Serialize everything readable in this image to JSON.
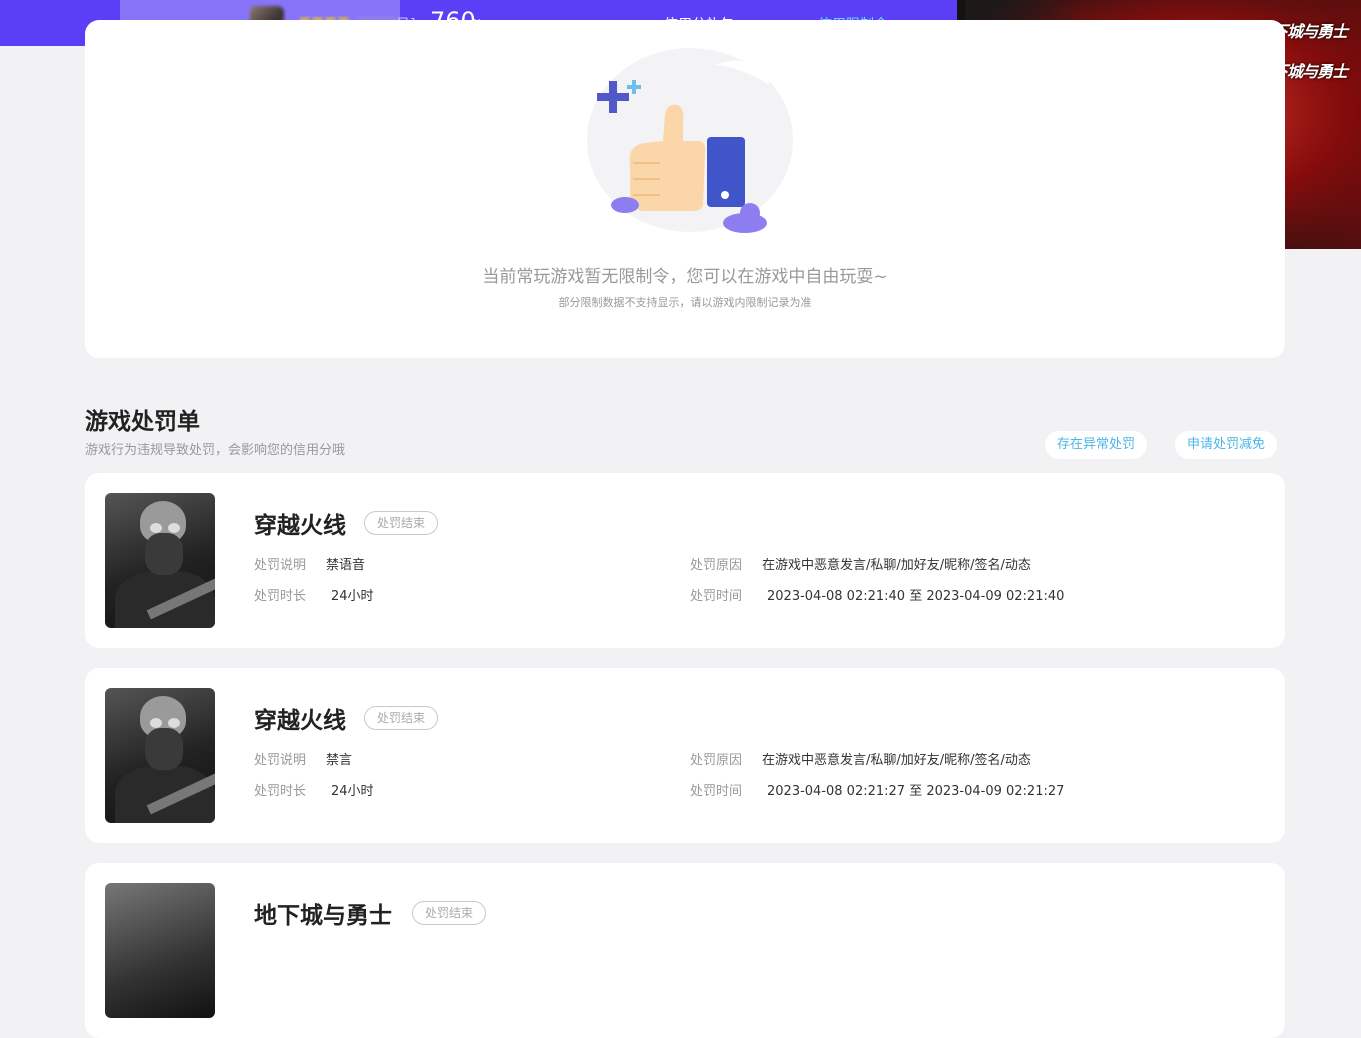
{
  "header": {
    "account_suffix": "号]",
    "credit_score": "760",
    "score_unit": "分",
    "tabs": [
      {
        "label": "信用分礼包",
        "active": false
      },
      {
        "label": "信用限制令",
        "active": true
      }
    ]
  },
  "colors": {
    "topbar": "#5a3ff7",
    "active_tab": "#4ad0ff",
    "link": "#4ab7e8"
  },
  "ad_banner": {
    "logo_text": "地下城与勇士"
  },
  "restrictions": {
    "empty_title": "当前常玩游戏暂无限制令，您可以在游戏中自由玩耍~",
    "empty_note": "部分限制数据不支持显示，请以游戏内限制记录为准"
  },
  "penalties": {
    "title": "游戏处罚单",
    "subtitle": "游戏行为违规导致处罚，会影响您的信用分哦",
    "actions": {
      "abnormal": "存在异常处罚",
      "appeal": "申请处罚减免"
    },
    "labels": {
      "desc": "处罚说明",
      "duration": "处罚时长",
      "reason": "处罚原因",
      "time": "处罚时间"
    },
    "items": [
      {
        "game": "穿越火线",
        "status": "处罚结束",
        "desc": "禁语音",
        "duration": "24小时",
        "reason": "在游戏中恶意发言/私聊/加好友/昵称/签名/动态",
        "time": "2023-04-08 02:21:40 至 2023-04-09 02:21:40"
      },
      {
        "game": "穿越火线",
        "status": "处罚结束",
        "desc": "禁言",
        "duration": "24小时",
        "reason": "在游戏中恶意发言/私聊/加好友/昵称/签名/动态",
        "time": "2023-04-08 02:21:27 至 2023-04-09 02:21:27"
      },
      {
        "game": "地下城与勇士",
        "status": "处罚结束"
      }
    ]
  }
}
